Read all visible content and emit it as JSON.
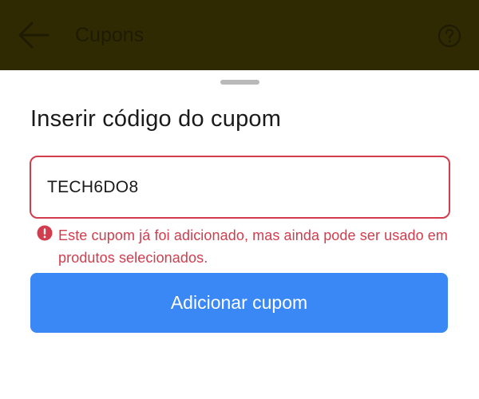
{
  "app_bar": {
    "title": "Cupons",
    "back_icon": "arrow-left-icon",
    "help_icon": "question-circle-icon",
    "background": "#302a03"
  },
  "sheet": {
    "title": "Inserir código do cupom",
    "input": {
      "value": "TECH6DO8",
      "placeholder": ""
    },
    "error": {
      "icon": "exclamation-circle-icon",
      "message": "Este cupom já foi adicionado, mas ainda pode ser usado em produtos selecionados.",
      "color": "#d23c4c"
    },
    "button": {
      "label": "Adicionar cupom",
      "color": "#3a88f5"
    }
  }
}
